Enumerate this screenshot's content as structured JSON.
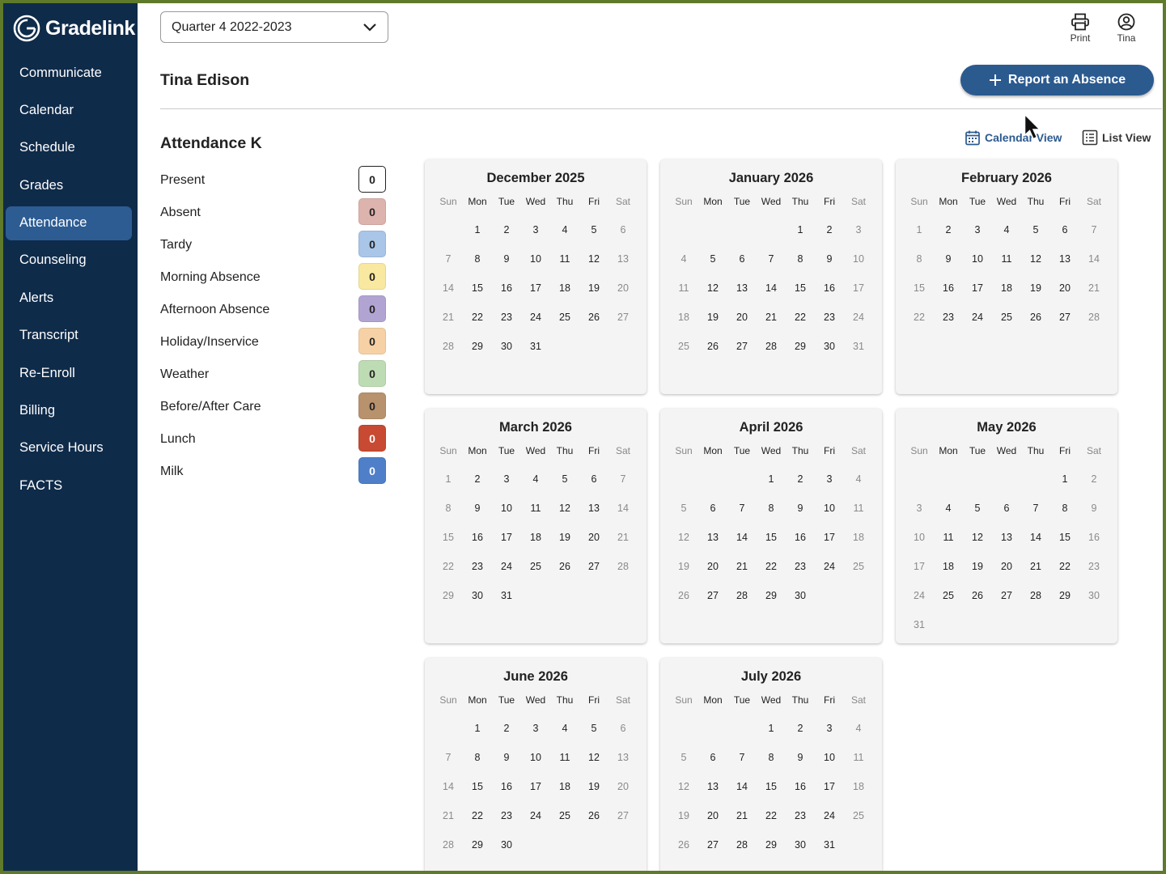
{
  "app": {
    "logo_text": "Gradelink"
  },
  "nav": [
    {
      "label": "Communicate",
      "name": "communicate"
    },
    {
      "label": "Calendar",
      "name": "calendar"
    },
    {
      "label": "Schedule",
      "name": "schedule"
    },
    {
      "label": "Grades",
      "name": "grades"
    },
    {
      "label": "Attendance",
      "name": "attendance",
      "active": true
    },
    {
      "label": "Counseling",
      "name": "counseling"
    },
    {
      "label": "Alerts",
      "name": "alerts"
    },
    {
      "label": "Transcript",
      "name": "transcript"
    },
    {
      "label": "Re-Enroll",
      "name": "re-enroll"
    },
    {
      "label": "Billing",
      "name": "billing"
    },
    {
      "label": "Service Hours",
      "name": "service-hours"
    },
    {
      "label": "FACTS",
      "name": "facts"
    }
  ],
  "header": {
    "quarter": "Quarter 4 2022-2023",
    "print_label": "Print",
    "user_label": "Tina"
  },
  "student": {
    "name": "Tina Edison"
  },
  "report_button": {
    "label": "Report an Absence",
    "icon": "plus-icon"
  },
  "attendance": {
    "title": "Attendance K",
    "legend": [
      {
        "label": "Present",
        "count": "0",
        "color": "#ffffff",
        "border": "#222222"
      },
      {
        "label": "Absent",
        "count": "0",
        "color": "#ddb3ad"
      },
      {
        "label": "Tardy",
        "count": "0",
        "color": "#a9c5e7"
      },
      {
        "label": "Morning Absence",
        "count": "0",
        "color": "#f9e8a0"
      },
      {
        "label": "Afternoon Absence",
        "count": "0",
        "color": "#b2a4d2"
      },
      {
        "label": "Holiday/Inservice",
        "count": "0",
        "color": "#f6d1a6"
      },
      {
        "label": "Weather",
        "count": "0",
        "color": "#bedcb4"
      },
      {
        "label": "Before/After Care",
        "count": "0",
        "color": "#b8926d"
      },
      {
        "label": "Lunch",
        "count": "0",
        "color": "#c84a32"
      },
      {
        "label": "Milk",
        "count": "0",
        "color": "#4f7fc8"
      }
    ]
  },
  "views": {
    "calendar": "Calendar View",
    "list": "List View",
    "active": "calendar"
  },
  "weekdays": [
    "Sun",
    "Mon",
    "Tue",
    "Wed",
    "Thu",
    "Fri",
    "Sat"
  ],
  "months": [
    {
      "title": "December 2025",
      "start": 1,
      "days": 31
    },
    {
      "title": "January 2026",
      "start": 4,
      "days": 31
    },
    {
      "title": "February 2026",
      "start": 0,
      "days": 28
    },
    {
      "title": "March 2026",
      "start": 0,
      "days": 31
    },
    {
      "title": "April 2026",
      "start": 3,
      "days": 30
    },
    {
      "title": "May 2026",
      "start": 5,
      "days": 31
    },
    {
      "title": "June 2026",
      "start": 1,
      "days": 30
    },
    {
      "title": "July 2026",
      "start": 3,
      "days": 31
    }
  ],
  "colors": {
    "sidebar": "#0f2b4a",
    "accent": "#2b5a8f",
    "active_nav": "#2d5c93"
  }
}
